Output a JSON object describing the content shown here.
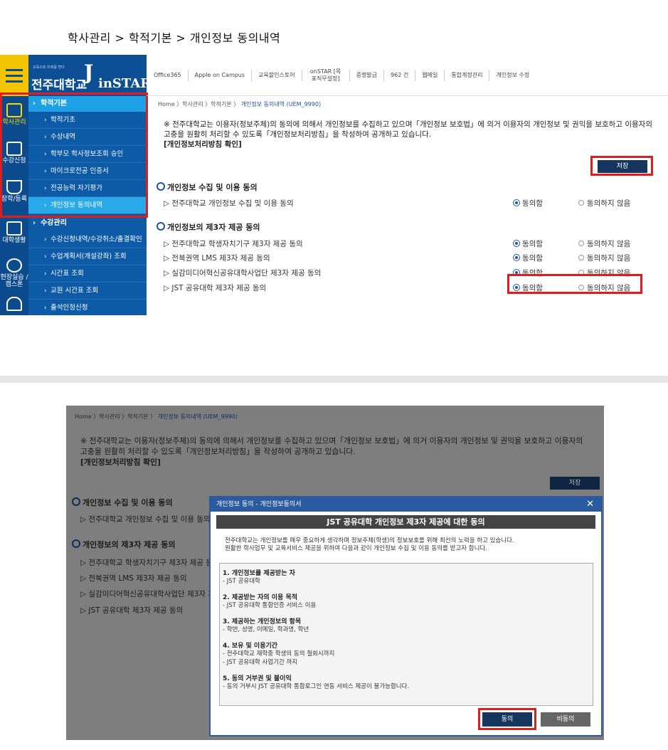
{
  "top_breadcrumb": "학사관리 > 학적기본 > 개인정보 동의내역",
  "portal": {
    "logo_small": "교육으로 미래를 연다",
    "logo_school": "전주대학교",
    "logo_app": "inSTAR",
    "side_categories": [
      "학사관리",
      "수강신청",
      "장학/등록",
      "대학생활",
      "현장실습 / 캠스톤"
    ],
    "menu": {
      "group1": "학적기본",
      "group1_items": [
        "학적기초",
        "수상내역",
        "학부모 학사정보조회 승인",
        "마이크로전공 인증서",
        "전공능력 자기평가",
        "개인정보 동의내역"
      ],
      "group2": "수강관리",
      "group2_items": [
        "수강신청내역/수강취소/출결확인",
        "수업계획서(개설강좌) 조회",
        "시간표 조회",
        "교원 시간표 조회",
        "출석인정신청"
      ]
    },
    "topbar": [
      "Office365",
      "Apple on Campus",
      "교육할인스토어",
      "onSTAR [목표직무설정]",
      "증명발급",
      "962 건",
      "웹메일",
      "통합계정관리",
      "개인정보 수정"
    ]
  },
  "page": {
    "breadcrumb_prefix": "Home 〉학사관리 〉학적기본 〉",
    "breadcrumb_current": "개인정보 동의내역 (UEM_9990)",
    "notice_line1": "※ 전주대학교는 이용자(정보주체)의 동의에 의해서 개인정보를 수집하고 있으며「개인정보 보호법」에 의거 이용자의 개인정보 및 권익을 보호하고 이용자의",
    "notice_line2": "고충을 원활히 처리할 수 있도록「개인정보처리방침」을 작성하여 공개하고 있습니다.",
    "policy_link": "[개인정보처리방침 확인]",
    "save_label": "저장",
    "section1": "개인정보 수집 및 이용 동의",
    "section1_items": [
      "▷ 전주대학교 개인정보 수집 및 이용 동의"
    ],
    "section2": "개인정보의 제3자 제공 동의",
    "section2_items": [
      "▷ 전주대학교 학생자치기구 제3자 제공 동의",
      "▷ 전북권역 LMS 제3자 제공 동의",
      "▷ 실감미디어혁신공유대학사업단 제3자 제공 동의",
      "▷ JST 공유대학 제3자 제공 동의"
    ],
    "agree": "동의함",
    "disagree": "동의하지 않음"
  },
  "modal": {
    "header": "개인정보 동의 - 개인정보동의서",
    "close": "✕",
    "title": "JST 공유대학 개인정보 제3자 제공에 대한 동의",
    "intro1": "전주대학교는 개인정보를 매우 중요하게 생각하며 정보주체(학생)의 정보보호를 위해 최선의 노력을 하고 있습니다.",
    "intro2": "원활한 학사업무 및 교육서비스 제공을 위하여 다음과 같이 개인정보 수집 및 이용 동의를 받고자 합니다.",
    "items": [
      {
        "h": "1. 개인정보를 제공받는 자",
        "d": [
          "- JST 공유대학"
        ]
      },
      {
        "h": "2. 제공받는 자의 이용 목적",
        "d": [
          "- JST 공유대학 통합인증 서비스 이용"
        ]
      },
      {
        "h": "3. 제공하는 개인정보의 항목",
        "d": [
          "- 학번, 성명, 이메일, 학과명, 학년"
        ]
      },
      {
        "h": "4. 보유 및 이용기간",
        "d": [
          "- 전주대학교 재학중 학생의 동의 철회시까지",
          "- JST 공유대학 사업기간 까지"
        ]
      },
      {
        "h": "5. 동의 거부권 및 불이익",
        "d": [
          "- 동의 거부시 JST 공유대학 통합로그인 연동 서비스 제공이 불가능합니다."
        ]
      }
    ],
    "agree_btn": "동의",
    "disagree_btn": "비동의"
  },
  "colors": {
    "highlight": "#e01d1d",
    "navy": "#17365f",
    "menu_blue": "#0d5aa7",
    "accent_yellow": "#f4c400"
  }
}
